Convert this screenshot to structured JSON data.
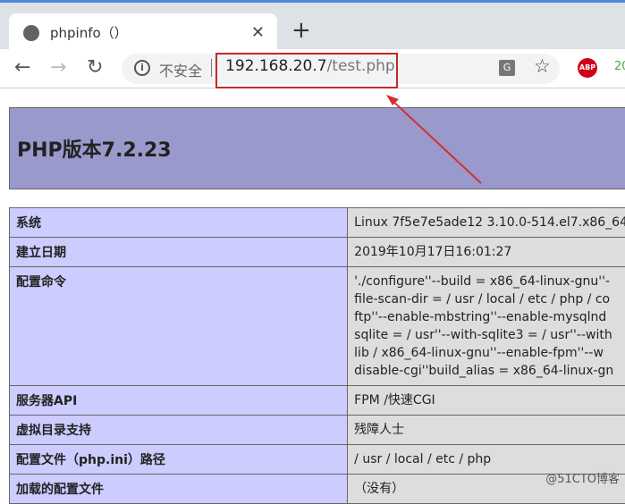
{
  "browser": {
    "tab_title": "phpinfo（）",
    "url_host": "192.168.20.7",
    "url_path": "/test.php",
    "security_label": "不安全",
    "extension_abp": "ABP",
    "extension_other": "20"
  },
  "page": {
    "title": "PHP版本7.2.23",
    "rows": [
      {
        "key": "系统",
        "value": [
          "Linux 7f5e7e5ade12 3.10.0-514.el7.x86_64"
        ]
      },
      {
        "key": "建立日期",
        "value": [
          "2019年10月17日16:01:27"
        ]
      },
      {
        "key": "配置命令",
        "value": [
          "'./configure''--build = x86_64-linux-gnu''-",
          "file-scan-dir = / usr / local / etc / php / co",
          "ftp''--enable-mbstring''--enable-mysqlnd",
          "sqlite = / usr''--with-sqlite3 = / usr''--with",
          "lib / x86_64-linux-gnu''--enable-fpm''--w",
          "disable-cgi''build_alias = x86_64-linux-gn"
        ]
      },
      {
        "key": "服务器API",
        "value": [
          "FPM /快速CGI"
        ]
      },
      {
        "key": "虚拟目录支持",
        "value": [
          "残障人士"
        ]
      },
      {
        "key": "配置文件（php.ini）路径",
        "value": [
          "/ usr / local / etc / php"
        ]
      },
      {
        "key": "加载的配置文件",
        "value": [
          "（没有）"
        ]
      }
    ]
  },
  "watermark": "@51CTO博客"
}
